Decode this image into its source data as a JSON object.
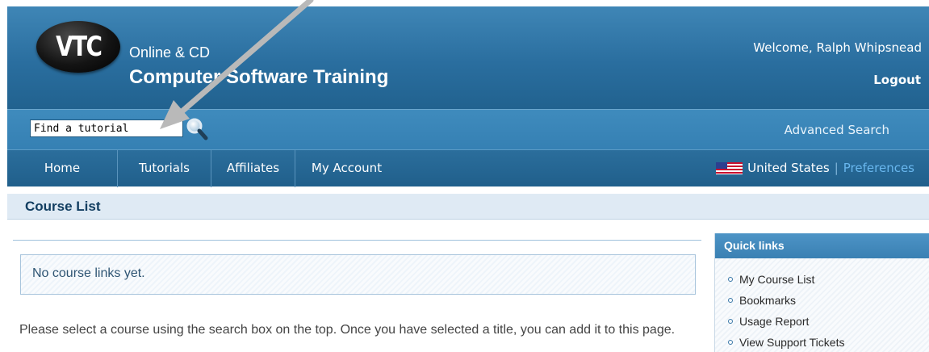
{
  "header": {
    "logo": "VTC",
    "tagline_small": "Online & CD",
    "tagline_big": "Computer Software Training",
    "welcome": "Welcome, Ralph Whipsnead",
    "logout": "Logout"
  },
  "search": {
    "value": "Find a tutorial",
    "button_icon": "magnifier-icon",
    "advanced": "Advanced Search"
  },
  "nav": {
    "items": [
      {
        "label": "Home"
      },
      {
        "label": "Tutorials"
      },
      {
        "label": "Affiliates"
      },
      {
        "label": "My Account"
      }
    ],
    "region": "United States",
    "separator": "|",
    "preferences": "Preferences",
    "flag_icon": "us-flag-icon"
  },
  "course": {
    "title": "Course List"
  },
  "main": {
    "empty_message": "No course links yet.",
    "instructions": "Please select a course using the search box on the top. Once you have selected a title, you can add it to this page."
  },
  "quick_links": {
    "title": "Quick links",
    "items": [
      {
        "label": "My Course List"
      },
      {
        "label": "Bookmarks"
      },
      {
        "label": "Usage Report"
      },
      {
        "label": "View Support Tickets"
      }
    ]
  },
  "colors": {
    "header_blue": "#2a6e9f",
    "nav_blue": "#205f8b",
    "preferences_link": "#69b7ee",
    "annotation_arrow": "#b9b9b9"
  }
}
